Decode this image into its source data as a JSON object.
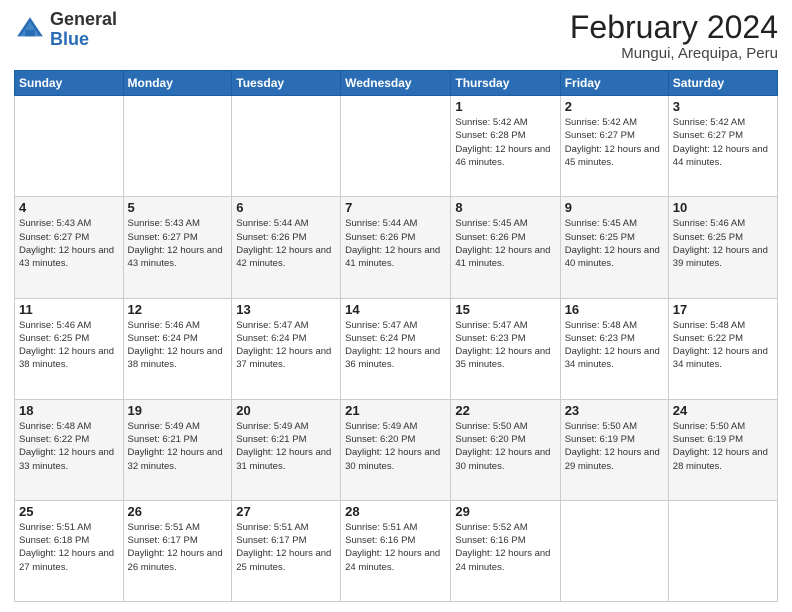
{
  "logo": {
    "general": "General",
    "blue": "Blue"
  },
  "title": "February 2024",
  "subtitle": "Mungui, Arequipa, Peru",
  "days_of_week": [
    "Sunday",
    "Monday",
    "Tuesday",
    "Wednesday",
    "Thursday",
    "Friday",
    "Saturday"
  ],
  "weeks": [
    [
      {
        "day": "",
        "info": ""
      },
      {
        "day": "",
        "info": ""
      },
      {
        "day": "",
        "info": ""
      },
      {
        "day": "",
        "info": ""
      },
      {
        "day": "1",
        "info": "Sunrise: 5:42 AM\nSunset: 6:28 PM\nDaylight: 12 hours and 46 minutes."
      },
      {
        "day": "2",
        "info": "Sunrise: 5:42 AM\nSunset: 6:27 PM\nDaylight: 12 hours and 45 minutes."
      },
      {
        "day": "3",
        "info": "Sunrise: 5:42 AM\nSunset: 6:27 PM\nDaylight: 12 hours and 44 minutes."
      }
    ],
    [
      {
        "day": "4",
        "info": "Sunrise: 5:43 AM\nSunset: 6:27 PM\nDaylight: 12 hours and 43 minutes."
      },
      {
        "day": "5",
        "info": "Sunrise: 5:43 AM\nSunset: 6:27 PM\nDaylight: 12 hours and 43 minutes."
      },
      {
        "day": "6",
        "info": "Sunrise: 5:44 AM\nSunset: 6:26 PM\nDaylight: 12 hours and 42 minutes."
      },
      {
        "day": "7",
        "info": "Sunrise: 5:44 AM\nSunset: 6:26 PM\nDaylight: 12 hours and 41 minutes."
      },
      {
        "day": "8",
        "info": "Sunrise: 5:45 AM\nSunset: 6:26 PM\nDaylight: 12 hours and 41 minutes."
      },
      {
        "day": "9",
        "info": "Sunrise: 5:45 AM\nSunset: 6:25 PM\nDaylight: 12 hours and 40 minutes."
      },
      {
        "day": "10",
        "info": "Sunrise: 5:46 AM\nSunset: 6:25 PM\nDaylight: 12 hours and 39 minutes."
      }
    ],
    [
      {
        "day": "11",
        "info": "Sunrise: 5:46 AM\nSunset: 6:25 PM\nDaylight: 12 hours and 38 minutes."
      },
      {
        "day": "12",
        "info": "Sunrise: 5:46 AM\nSunset: 6:24 PM\nDaylight: 12 hours and 38 minutes."
      },
      {
        "day": "13",
        "info": "Sunrise: 5:47 AM\nSunset: 6:24 PM\nDaylight: 12 hours and 37 minutes."
      },
      {
        "day": "14",
        "info": "Sunrise: 5:47 AM\nSunset: 6:24 PM\nDaylight: 12 hours and 36 minutes."
      },
      {
        "day": "15",
        "info": "Sunrise: 5:47 AM\nSunset: 6:23 PM\nDaylight: 12 hours and 35 minutes."
      },
      {
        "day": "16",
        "info": "Sunrise: 5:48 AM\nSunset: 6:23 PM\nDaylight: 12 hours and 34 minutes."
      },
      {
        "day": "17",
        "info": "Sunrise: 5:48 AM\nSunset: 6:22 PM\nDaylight: 12 hours and 34 minutes."
      }
    ],
    [
      {
        "day": "18",
        "info": "Sunrise: 5:48 AM\nSunset: 6:22 PM\nDaylight: 12 hours and 33 minutes."
      },
      {
        "day": "19",
        "info": "Sunrise: 5:49 AM\nSunset: 6:21 PM\nDaylight: 12 hours and 32 minutes."
      },
      {
        "day": "20",
        "info": "Sunrise: 5:49 AM\nSunset: 6:21 PM\nDaylight: 12 hours and 31 minutes."
      },
      {
        "day": "21",
        "info": "Sunrise: 5:49 AM\nSunset: 6:20 PM\nDaylight: 12 hours and 30 minutes."
      },
      {
        "day": "22",
        "info": "Sunrise: 5:50 AM\nSunset: 6:20 PM\nDaylight: 12 hours and 30 minutes."
      },
      {
        "day": "23",
        "info": "Sunrise: 5:50 AM\nSunset: 6:19 PM\nDaylight: 12 hours and 29 minutes."
      },
      {
        "day": "24",
        "info": "Sunrise: 5:50 AM\nSunset: 6:19 PM\nDaylight: 12 hours and 28 minutes."
      }
    ],
    [
      {
        "day": "25",
        "info": "Sunrise: 5:51 AM\nSunset: 6:18 PM\nDaylight: 12 hours and 27 minutes."
      },
      {
        "day": "26",
        "info": "Sunrise: 5:51 AM\nSunset: 6:17 PM\nDaylight: 12 hours and 26 minutes."
      },
      {
        "day": "27",
        "info": "Sunrise: 5:51 AM\nSunset: 6:17 PM\nDaylight: 12 hours and 25 minutes."
      },
      {
        "day": "28",
        "info": "Sunrise: 5:51 AM\nSunset: 6:16 PM\nDaylight: 12 hours and 24 minutes."
      },
      {
        "day": "29",
        "info": "Sunrise: 5:52 AM\nSunset: 6:16 PM\nDaylight: 12 hours and 24 minutes."
      },
      {
        "day": "",
        "info": ""
      },
      {
        "day": "",
        "info": ""
      }
    ]
  ]
}
